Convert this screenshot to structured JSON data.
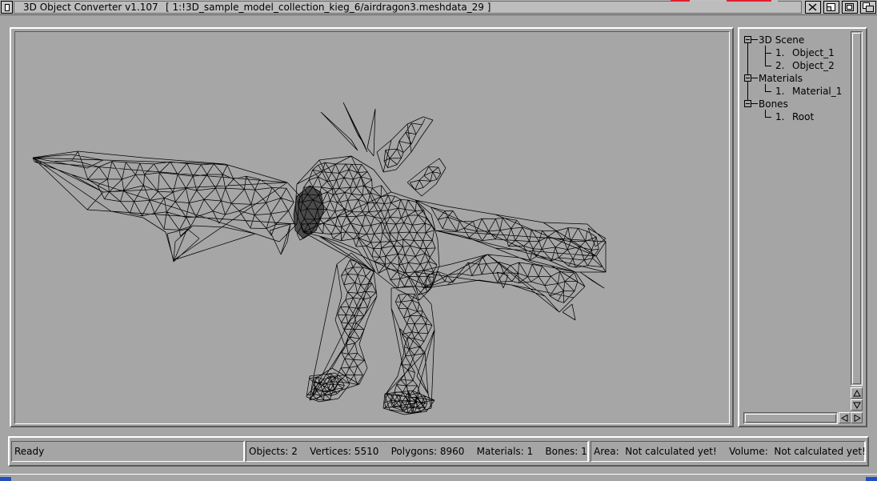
{
  "window": {
    "app_title": "3D Object Converter v1.107",
    "file_path": "[ 1:!3D_sample_model_collection_kieg_6/airdragon3.meshdata_29 ]"
  },
  "scene_tree": {
    "groups": [
      {
        "label": "3D Scene",
        "items": [
          {
            "index": "1.",
            "label": "Object_1"
          },
          {
            "index": "2.",
            "label": "Object_2"
          }
        ]
      },
      {
        "label": "Materials",
        "items": [
          {
            "index": "1.",
            "label": "Material_1"
          }
        ]
      },
      {
        "label": "Bones",
        "items": [
          {
            "index": "1.",
            "label": "Root"
          }
        ]
      }
    ]
  },
  "status": {
    "message": "Ready",
    "stats": "Objects: 2    Vertices: 5510    Polygons: 8960    Materials: 1    Bones: 1",
    "measures": "Area:  Not calculated yet!    Volume:  Not calculated yet!"
  },
  "viewport": {
    "model": "airdragon3 wireframe",
    "wire_color": "#000000",
    "background": "#a6a6a6"
  },
  "icons": {
    "close": "close-icon",
    "depth": "depth-icon",
    "zoom": "zoom-icon",
    "iconify": "iconify-icon",
    "tree_expander": "minus-box-icon",
    "scroll_up": "arrow-up-icon",
    "scroll_down": "arrow-down-icon",
    "scroll_left": "arrow-left-icon",
    "scroll_right": "arrow-right-icon"
  }
}
